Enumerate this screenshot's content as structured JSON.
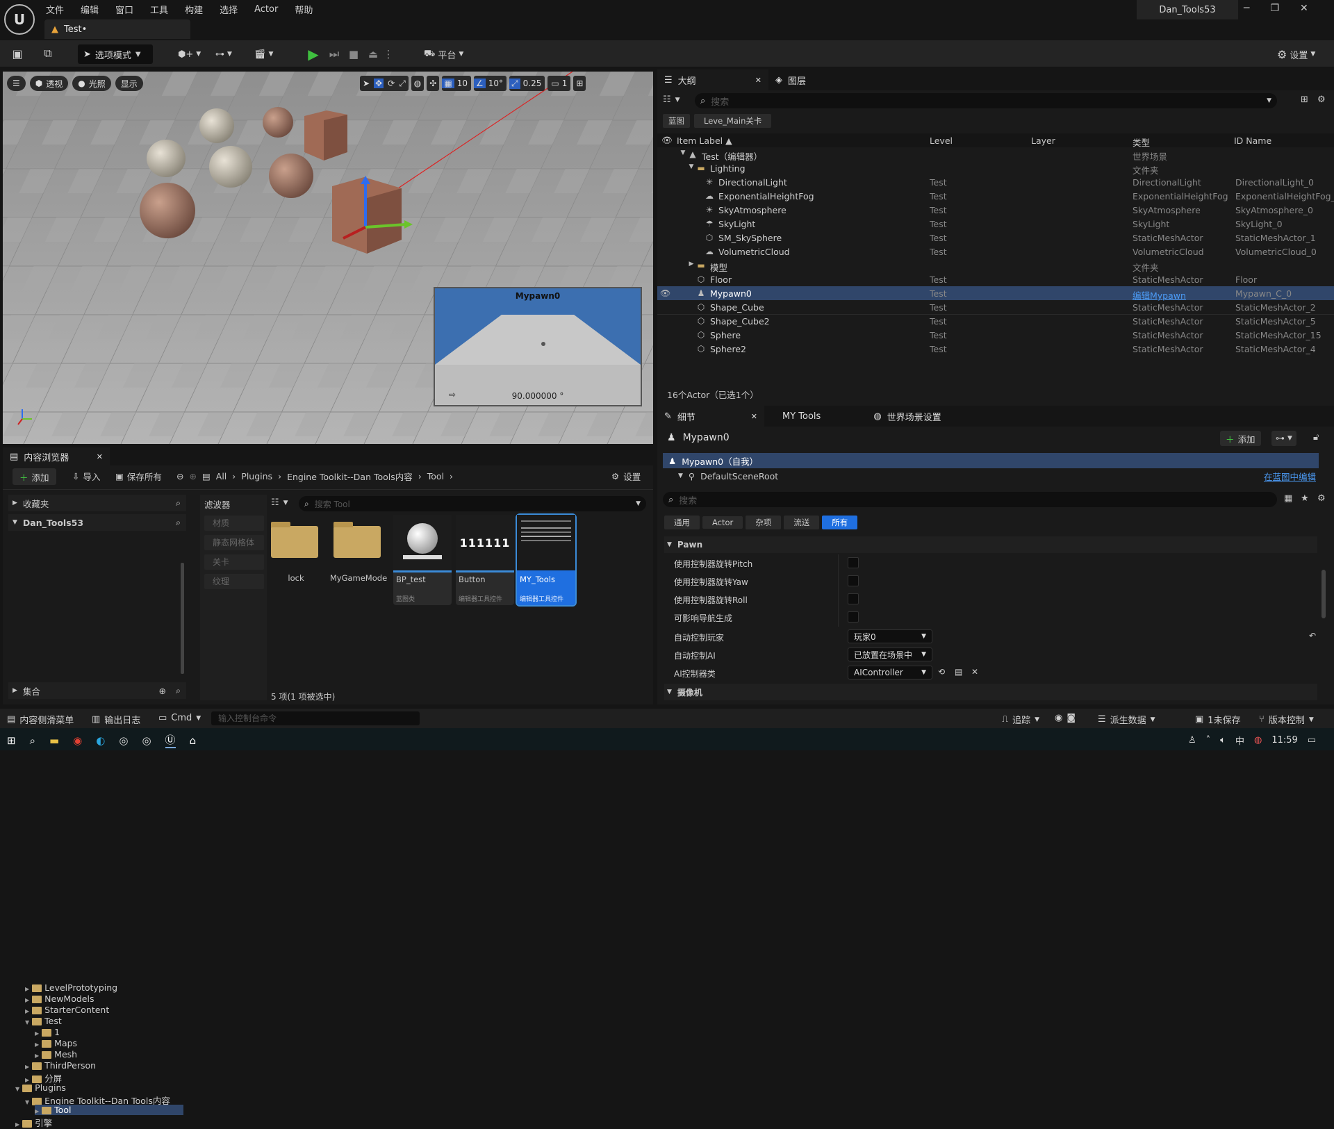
{
  "app": {
    "project_name": "Dan_Tools53",
    "tab_title": "Test•",
    "menu": [
      "文件",
      "编辑",
      "窗口",
      "工具",
      "构建",
      "选择",
      "Actor",
      "帮助"
    ]
  },
  "toolbar": {
    "mode_label": "选项模式",
    "platform_label": "平台",
    "settings_label": "设置"
  },
  "viewport": {
    "perspective_label": "透视",
    "lighting_label": "光照",
    "show_label": "显示",
    "grid_snap": "10",
    "rot_snap": "10°",
    "scale_snap": "0.25",
    "camera_speed": "1",
    "pip_title": "Mypawn0",
    "pip_fov": "90.000000 °"
  },
  "outliner": {
    "tab_label": "大纲",
    "layers_tab_label": "图层",
    "search_placeholder": "搜索",
    "filter_chips": [
      "蓝图",
      "Leve_Main关卡"
    ],
    "columns": [
      "Item Label ▲",
      "Level",
      "Layer",
      "类型",
      "ID Name"
    ],
    "rows": [
      {
        "label": "Test（编辑器）",
        "level": "",
        "type": "世界场景",
        "id": "",
        "indent": 0,
        "icon": "level"
      },
      {
        "label": "Lighting",
        "level": "",
        "type": "文件夹",
        "id": "",
        "indent": 1,
        "icon": "folder"
      },
      {
        "label": "DirectionalLight",
        "level": "Test",
        "type": "DirectionalLight",
        "id": "DirectionalLight_0",
        "indent": 2,
        "icon": "light"
      },
      {
        "label": "ExponentialHeightFog",
        "level": "Test",
        "type": "ExponentialHeightFog",
        "id": "ExponentialHeightFog_0",
        "indent": 2,
        "icon": "fog"
      },
      {
        "label": "SkyAtmosphere",
        "level": "Test",
        "type": "SkyAtmosphere",
        "id": "SkyAtmosphere_0",
        "indent": 2,
        "icon": "sky"
      },
      {
        "label": "SkyLight",
        "level": "Test",
        "type": "SkyLight",
        "id": "SkyLight_0",
        "indent": 2,
        "icon": "skylight"
      },
      {
        "label": "SM_SkySphere",
        "level": "Test",
        "type": "StaticMeshActor",
        "id": "StaticMeshActor_1",
        "indent": 2,
        "icon": "mesh"
      },
      {
        "label": "VolumetricCloud",
        "level": "Test",
        "type": "VolumetricCloud",
        "id": "VolumetricCloud_0",
        "indent": 2,
        "icon": "cloud"
      },
      {
        "label": "模型",
        "level": "",
        "type": "文件夹",
        "id": "",
        "indent": 1,
        "icon": "folder"
      },
      {
        "label": "Floor",
        "level": "Test",
        "type": "StaticMeshActor",
        "id": "Floor",
        "indent": 1,
        "icon": "mesh"
      },
      {
        "label": "Mypawn0",
        "level": "Test",
        "type": "编辑Mypawn",
        "id": "Mypawn_C_0",
        "indent": 1,
        "icon": "pawn"
      },
      {
        "label": "Shape_Cube",
        "level": "Test",
        "type": "StaticMeshActor",
        "id": "StaticMeshActor_2",
        "indent": 1,
        "icon": "mesh"
      },
      {
        "label": "Shape_Cube2",
        "level": "Test",
        "type": "StaticMeshActor",
        "id": "StaticMeshActor_5",
        "indent": 1,
        "icon": "mesh"
      },
      {
        "label": "Sphere",
        "level": "Test",
        "type": "StaticMeshActor",
        "id": "StaticMeshActor_15",
        "indent": 1,
        "icon": "mesh"
      },
      {
        "label": "Sphere2",
        "level": "Test",
        "type": "StaticMeshActor",
        "id": "StaticMeshActor_4",
        "indent": 1,
        "icon": "mesh"
      }
    ],
    "footer": "16个Actor（已选1个）"
  },
  "details": {
    "tab_label": "细节",
    "mytools_tab": "MY Tools",
    "world_tab": "世界场景设置",
    "actor_name": "Mypawn0",
    "add_label": "添加",
    "self_label": "Mypawn0（自我）",
    "root_label": "DefaultSceneRoot",
    "edit_in_bp": "在蓝图中编辑",
    "search_placeholder": "搜索",
    "filters": [
      "通用",
      "Actor",
      "杂项",
      "流送",
      "所有"
    ],
    "section_pawn": "Pawn",
    "props": [
      {
        "label": "使用控制器旋转Pitch"
      },
      {
        "label": "使用控制器旋转Yaw"
      },
      {
        "label": "使用控制器旋转Roll"
      },
      {
        "label": "可影响导航生成"
      }
    ],
    "auto_possess_label": "自动控制玩家",
    "auto_possess_value": "玩家0",
    "auto_possess_ai_label": "自动控制AI",
    "auto_possess_ai_value": "已放置在场景中",
    "ai_class_label": "AI控制器类",
    "ai_class_value": "AIController",
    "section_camera": "摄像机"
  },
  "content_browser": {
    "tab_label": "内容浏览器",
    "add_label": "添加",
    "import_label": "导入",
    "save_all_label": "保存所有",
    "breadcrumb": [
      "All",
      "Plugins",
      "Engine Toolkit--Dan Tools内容",
      "Tool"
    ],
    "settings_label": "设置",
    "favorites_label": "收藏夹",
    "project_root": "Dan_Tools53",
    "filters_label": "滤波器",
    "filter_items": [
      "材质",
      "静态网格体",
      "关卡",
      "纹理"
    ],
    "search_placeholder": "搜索 Tool",
    "tree": [
      {
        "label": "LevelPrototyping",
        "indent": 1
      },
      {
        "label": "NewModels",
        "indent": 1
      },
      {
        "label": "StarterContent",
        "indent": 1
      },
      {
        "label": "Test",
        "indent": 1
      },
      {
        "label": "1",
        "indent": 2
      },
      {
        "label": "Maps",
        "indent": 2
      },
      {
        "label": "Mesh",
        "indent": 2
      },
      {
        "label": "ThirdPerson",
        "indent": 1
      },
      {
        "label": "分屏",
        "indent": 1
      },
      {
        "label": "Plugins",
        "indent": 0
      },
      {
        "label": "Engine Toolkit--Dan Tools内容",
        "indent": 1
      },
      {
        "label": "Tool",
        "indent": 2
      },
      {
        "label": "引擎",
        "indent": 0
      }
    ],
    "collections_label": "集合",
    "assets": [
      {
        "name": "lock",
        "type": ""
      },
      {
        "name": "MyGameMode",
        "type": ""
      },
      {
        "name": "BP_test",
        "type": "蓝图类"
      },
      {
        "name": "Button",
        "type": "编辑器工具控件"
      },
      {
        "name": "MY_Tools",
        "type": "编辑器工具控件"
      }
    ],
    "button_thumb_text": "111111",
    "footer": "5 项(1 项被选中)"
  },
  "statusbar": {
    "drawer_label": "内容侧滑菜单",
    "output_label": "输出日志",
    "cmd_label": "Cmd",
    "console_placeholder": "输入控制台命令",
    "trace_label": "追踪",
    "derived_label": "派生数据",
    "unsaved_label": "1未保存",
    "source_control_label": "版本控制"
  },
  "taskbar": {
    "time": "11:59"
  }
}
